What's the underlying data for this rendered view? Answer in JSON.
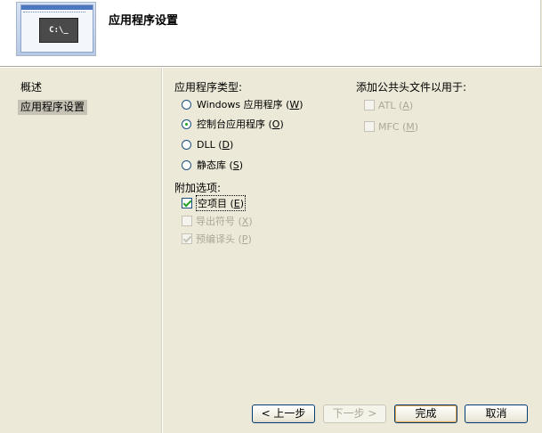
{
  "header": {
    "title": "应用程序设置",
    "console_text": "C:\\_"
  },
  "sidebar": {
    "items": [
      {
        "label": "概述",
        "selected": false
      },
      {
        "label": "应用程序设置",
        "selected": true
      }
    ]
  },
  "app_type": {
    "label": "应用程序类型:",
    "options": [
      {
        "text": "Windows 应用程序 (",
        "key": "W",
        "checked": false
      },
      {
        "text": "控制台应用程序 (",
        "key": "O",
        "checked": true
      },
      {
        "text": "DLL (",
        "key": "D",
        "checked": false
      },
      {
        "text": "静态库 (",
        "key": "S",
        "checked": false
      }
    ]
  },
  "extra_options": {
    "label": "附加选项:",
    "items": [
      {
        "text": "空项目 (",
        "key": "E",
        "checked": true,
        "disabled": false
      },
      {
        "text": "导出符号 (",
        "key": "X",
        "checked": false,
        "disabled": true
      },
      {
        "text": "预编译头 (",
        "key": "P",
        "checked": true,
        "disabled": true
      }
    ]
  },
  "common_headers": {
    "label": "添加公共头文件以用于:",
    "items": [
      {
        "text": "ATL (",
        "key": "A",
        "checked": false,
        "disabled": true
      },
      {
        "text": "MFC (",
        "key": "M",
        "checked": false,
        "disabled": true
      }
    ]
  },
  "buttons": {
    "back": "< 上一步",
    "next": "下一步 >",
    "finish": "完成",
    "cancel": "取消"
  }
}
